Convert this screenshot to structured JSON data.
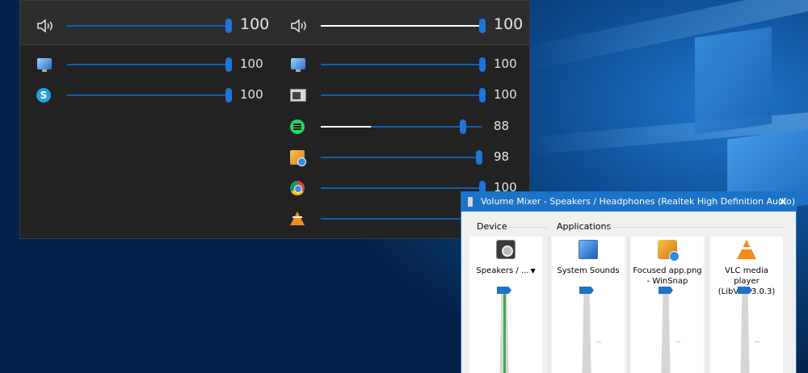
{
  "flyout": {
    "left_column": {
      "device": {
        "icon": "speaker-icon",
        "volume": 100,
        "value_label": "100"
      },
      "apps": [
        {
          "icon": "system-sounds-icon",
          "volume": 100,
          "value_label": "100"
        },
        {
          "icon": "skype-icon",
          "icon_text": "S",
          "volume": 100,
          "value_label": "100"
        }
      ]
    },
    "right_column": {
      "device": {
        "icon": "speaker-icon",
        "volume": 100,
        "fill": 100,
        "value_label": "100"
      },
      "apps": [
        {
          "icon": "system-sounds-icon",
          "volume": 100,
          "value_label": "100"
        },
        {
          "icon": "window-icon",
          "volume": 100,
          "value_label": "100"
        },
        {
          "icon": "spotify-icon",
          "volume": 88,
          "fill": 31,
          "value_label": "88"
        },
        {
          "icon": "winsnap-icon",
          "volume": 98,
          "value_label": "98"
        },
        {
          "icon": "chrome-icon",
          "volume": 100,
          "value_label": "100"
        },
        {
          "icon": "vlc-icon",
          "volume": 100,
          "value_label": ""
        }
      ]
    }
  },
  "mixer": {
    "title": "Volume Mixer - Speakers / Headphones (Realtek High Definition Audio)",
    "close_glyph": "✕",
    "device_group_label": "Device",
    "applications_group_label": "Applications",
    "device": {
      "name": "Speakers / ...",
      "dropdown_glyph": "▼",
      "icon": "speaker-device-icon",
      "level": 100
    },
    "applications": [
      {
        "name_line1": "System Sounds",
        "name_line2": "",
        "icon": "system-sounds-icon",
        "level": 100
      },
      {
        "name_line1": "Focused app.png",
        "name_line2": "- WinSnap",
        "icon": "winsnap-icon",
        "level": 100
      },
      {
        "name_line1": "VLC media player",
        "name_line2": "(LibVLC 3.0.3)",
        "icon": "vlc-icon",
        "level": 100
      }
    ]
  },
  "colors": {
    "accent": "#1c73c7",
    "flyout_bg": "#222222",
    "meter_green": "#3cb043"
  }
}
